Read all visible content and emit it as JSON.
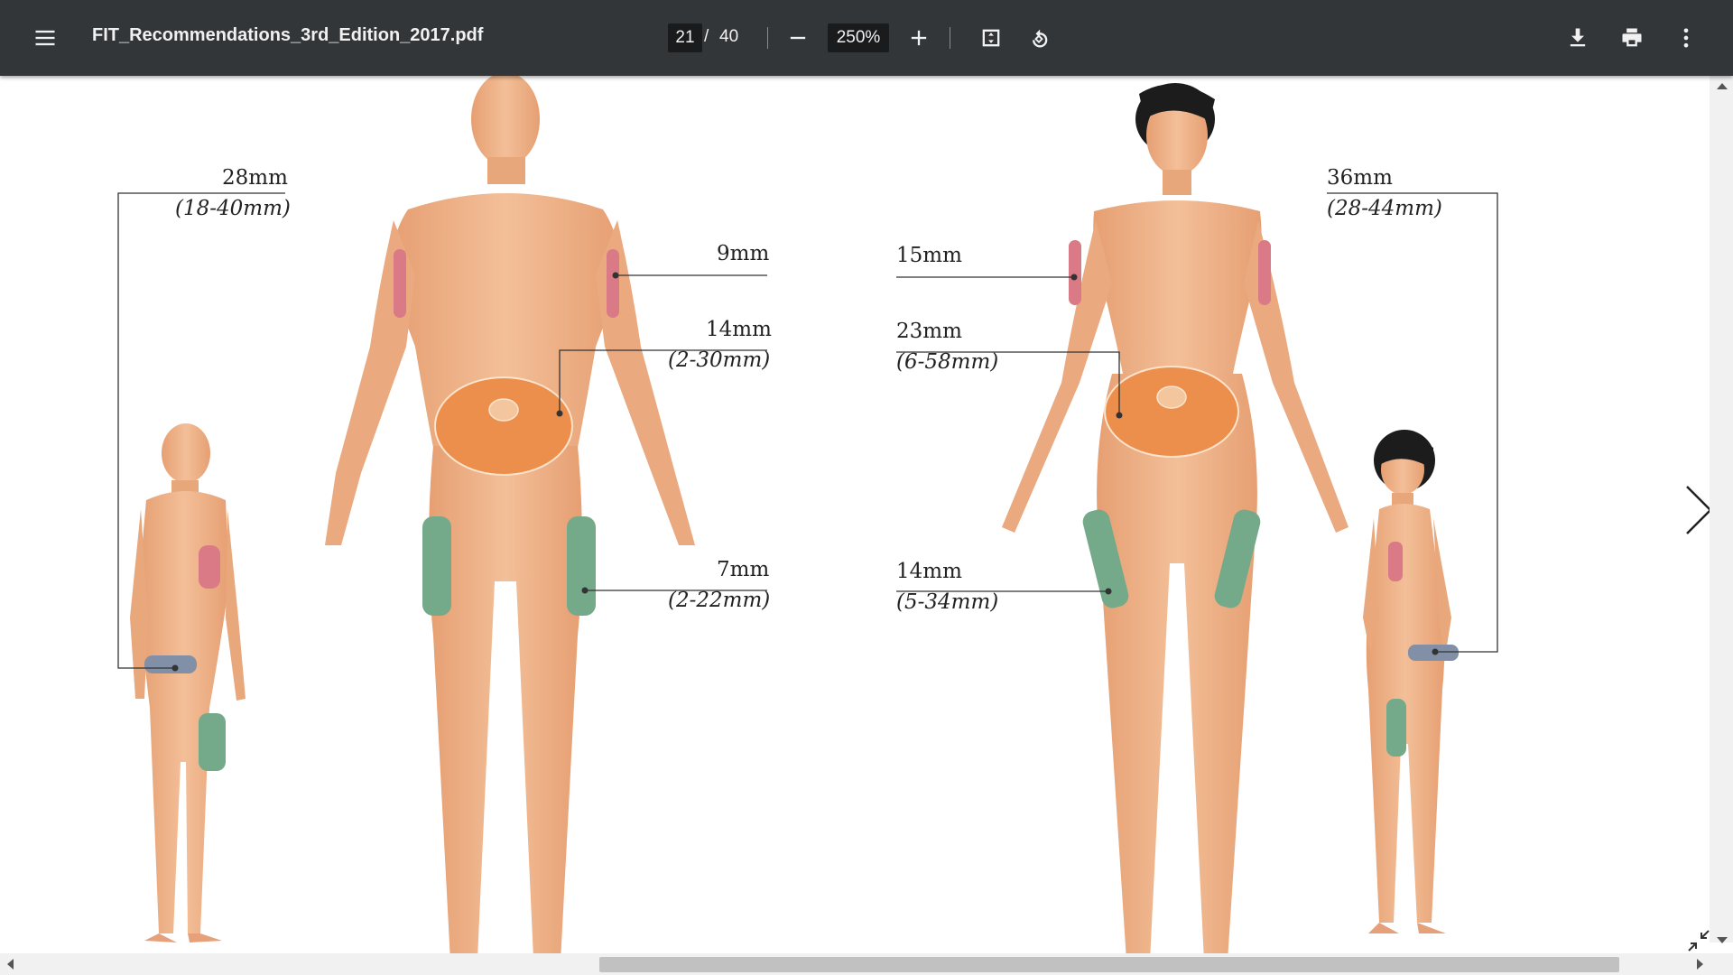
{
  "toolbar": {
    "menu_icon": "hamburger-menu-icon",
    "file_name": "FIT_Recommendations_3rd_Edition_2017.pdf",
    "current_page": "21",
    "page_separator": "/",
    "total_pages": "40",
    "zoom_level": "250%",
    "icons": {
      "zoom_out": "minus-icon",
      "zoom_in": "plus-icon",
      "fit": "fit-to-page-icon",
      "rotate": "rotate-counterclockwise-icon",
      "download": "download-icon",
      "print": "print-icon",
      "more": "more-vertical-icon"
    }
  },
  "figure": {
    "male": {
      "buttock": {
        "value": "28mm",
        "range": "(18-40mm)"
      },
      "arm": {
        "value": "9mm"
      },
      "abdomen": {
        "value": "14mm",
        "range": "(2-30mm)"
      },
      "thigh": {
        "value": "7mm",
        "range": "(2-22mm)"
      }
    },
    "female": {
      "arm": {
        "value": "15mm"
      },
      "abdomen": {
        "value": "23mm",
        "range": "(6-58mm)"
      },
      "thigh": {
        "value": "14mm",
        "range": "(5-34mm)"
      },
      "buttock": {
        "value": "36mm",
        "range": "(28-44mm)"
      }
    },
    "colors": {
      "skin": "#eeb187",
      "skin_shadow": "#d99468",
      "arm_zone": "#d97a86",
      "abdomen_zone": "#ed8f4c",
      "thigh_zone": "#74a98a",
      "buttock_zone": "#8190a6",
      "hair": "#1c1c1c"
    }
  },
  "viewer": {
    "next_page_icon": "chevron-right-icon",
    "collapse_icon": "collapse-arrows-icon"
  }
}
